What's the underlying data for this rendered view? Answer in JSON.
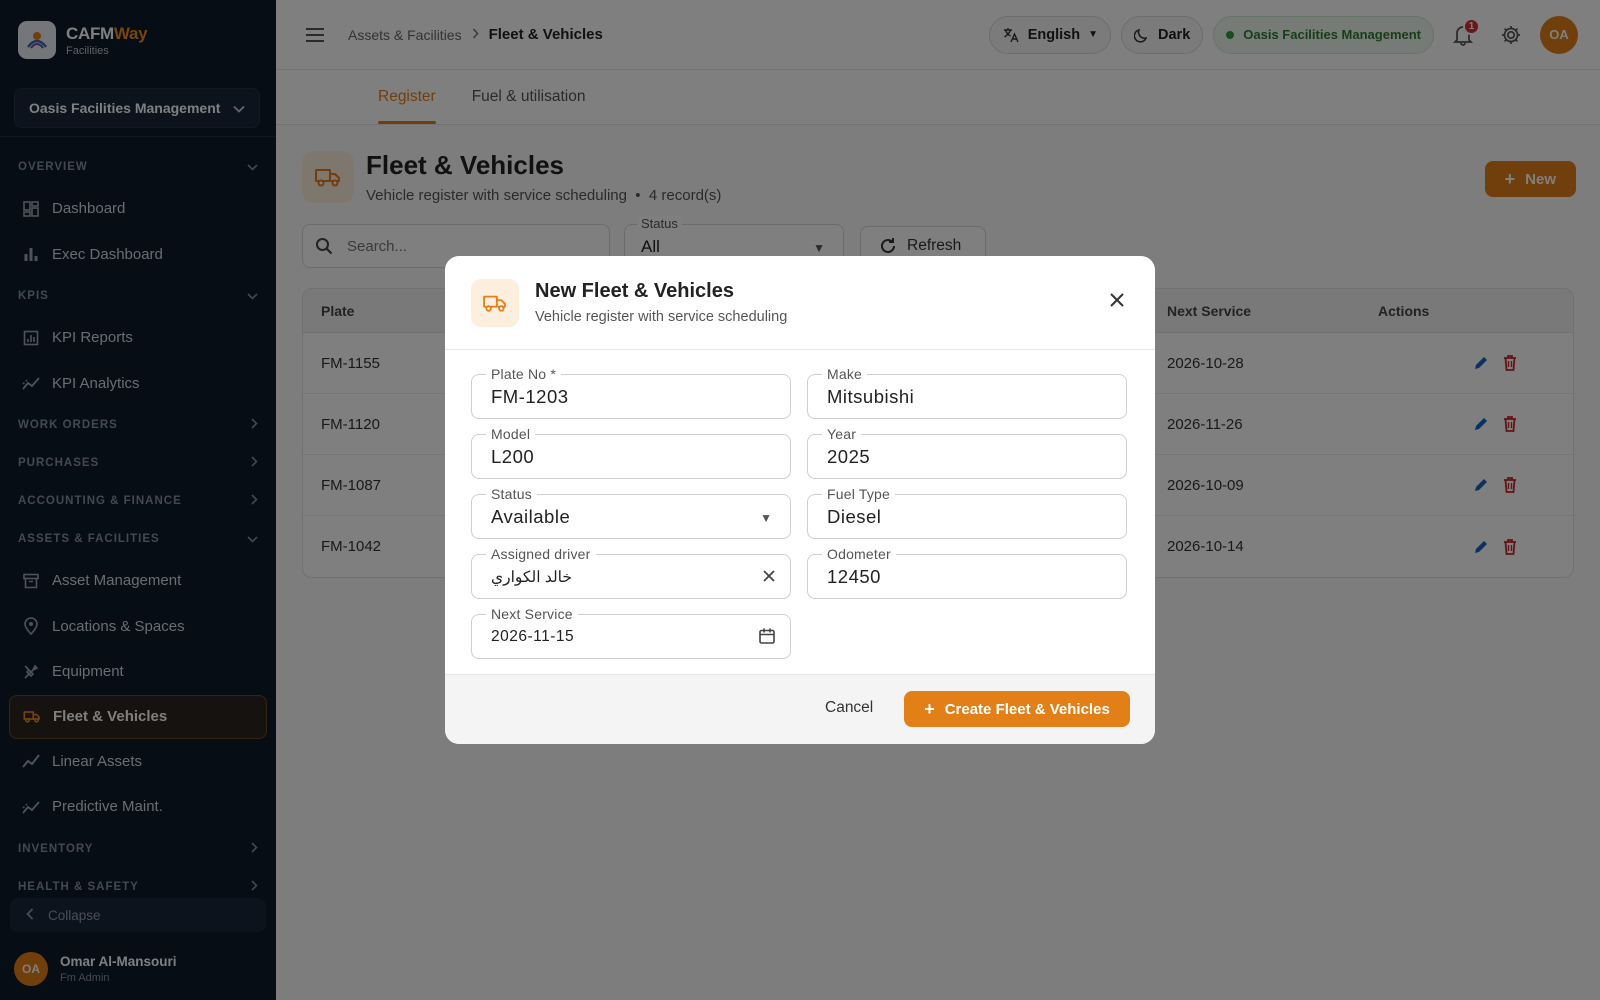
{
  "brand": {
    "name_main": "CAFM",
    "name_accent": "Way",
    "subtitle": "Facilities"
  },
  "sidebar": {
    "org": "Oasis Facilities Management",
    "nav": [
      {
        "type": "section",
        "label": "OVERVIEW",
        "expanded": true
      },
      {
        "type": "item",
        "label": "Dashboard",
        "icon": "dashboard-icon"
      },
      {
        "type": "item",
        "label": "Exec Dashboard",
        "icon": "bar-chart-icon"
      },
      {
        "type": "section",
        "label": "KPIS",
        "expanded": true
      },
      {
        "type": "item",
        "label": "KPI Reports",
        "icon": "report-icon"
      },
      {
        "type": "item",
        "label": "KPI Analytics",
        "icon": "analytics-icon"
      },
      {
        "type": "section",
        "label": "WORK ORDERS",
        "expanded": false
      },
      {
        "type": "section",
        "label": "PURCHASES",
        "expanded": false
      },
      {
        "type": "section",
        "label": "ACCOUNTING & FINANCE",
        "expanded": false
      },
      {
        "type": "section",
        "label": "ASSETS & FACILITIES",
        "expanded": true
      },
      {
        "type": "item",
        "label": "Asset Management",
        "icon": "archive-icon"
      },
      {
        "type": "item",
        "label": "Locations & Spaces",
        "icon": "location-pin-icon"
      },
      {
        "type": "item",
        "label": "Equipment",
        "icon": "tools-icon"
      },
      {
        "type": "item",
        "label": "Fleet & Vehicles",
        "icon": "truck-icon",
        "active": true
      },
      {
        "type": "item",
        "label": "Linear Assets",
        "icon": "trend-line-icon"
      },
      {
        "type": "item",
        "label": "Predictive Maint.",
        "icon": "analytics-icon"
      },
      {
        "type": "section",
        "label": "INVENTORY",
        "expanded": false
      },
      {
        "type": "section",
        "label": "HEALTH & SAFETY",
        "expanded": false
      }
    ],
    "collapse_label": "Collapse",
    "user": {
      "initials": "OA",
      "name": "Omar Al-Mansouri",
      "role": "Fm Admin"
    }
  },
  "topbar": {
    "breadcrumb_parent": "Assets & Facilities",
    "breadcrumb_current": "Fleet & Vehicles",
    "language": "English",
    "theme": "Dark",
    "org_badge": "Oasis Facilities Management",
    "notifications": "1",
    "avatar_initials": "OA"
  },
  "tabs": [
    {
      "label": "Register",
      "active": true
    },
    {
      "label": "Fuel & utilisation",
      "active": false
    }
  ],
  "page": {
    "title": "Fleet & Vehicles",
    "subtitle": "Vehicle register with service scheduling",
    "record_count": "4 record(s)",
    "new_label": "New"
  },
  "filters": {
    "search_placeholder": "Search...",
    "status_label": "Status",
    "status_value": "All",
    "refresh_label": "Refresh"
  },
  "table": {
    "headers": {
      "plate": "Plate",
      "next_service": "Next Service",
      "actions": "Actions"
    },
    "rows": [
      {
        "plate": "FM-1155",
        "next_service": "2026-10-28"
      },
      {
        "plate": "FM-1120",
        "next_service": "2026-11-26"
      },
      {
        "plate": "FM-1087",
        "next_service": "2026-10-09"
      },
      {
        "plate": "FM-1042",
        "next_service": "2026-10-14"
      }
    ]
  },
  "modal": {
    "title": "New Fleet & Vehicles",
    "subtitle": "Vehicle register with service scheduling",
    "fields": {
      "plate_no": {
        "label": "Plate No *",
        "value": "FM-1203"
      },
      "make": {
        "label": "Make",
        "value": "Mitsubishi"
      },
      "model": {
        "label": "Model",
        "value": "L200"
      },
      "year": {
        "label": "Year",
        "value": "2025"
      },
      "status": {
        "label": "Status",
        "value": "Available"
      },
      "fuel_type": {
        "label": "Fuel Type",
        "value": "Diesel"
      },
      "assigned_driver": {
        "label": "Assigned driver",
        "value": "خالد الكواري"
      },
      "odometer": {
        "label": "Odometer",
        "value": "12450"
      },
      "next_service": {
        "label": "Next Service",
        "value": "2026-11-15"
      }
    },
    "cancel_label": "Cancel",
    "create_label": "Create Fleet & Vehicles"
  },
  "colors": {
    "accent": "#e27f16",
    "sidebar_bg": "#0f1b2a",
    "success": "#2e7d32",
    "danger": "#c62828",
    "edit": "#1565c0"
  }
}
